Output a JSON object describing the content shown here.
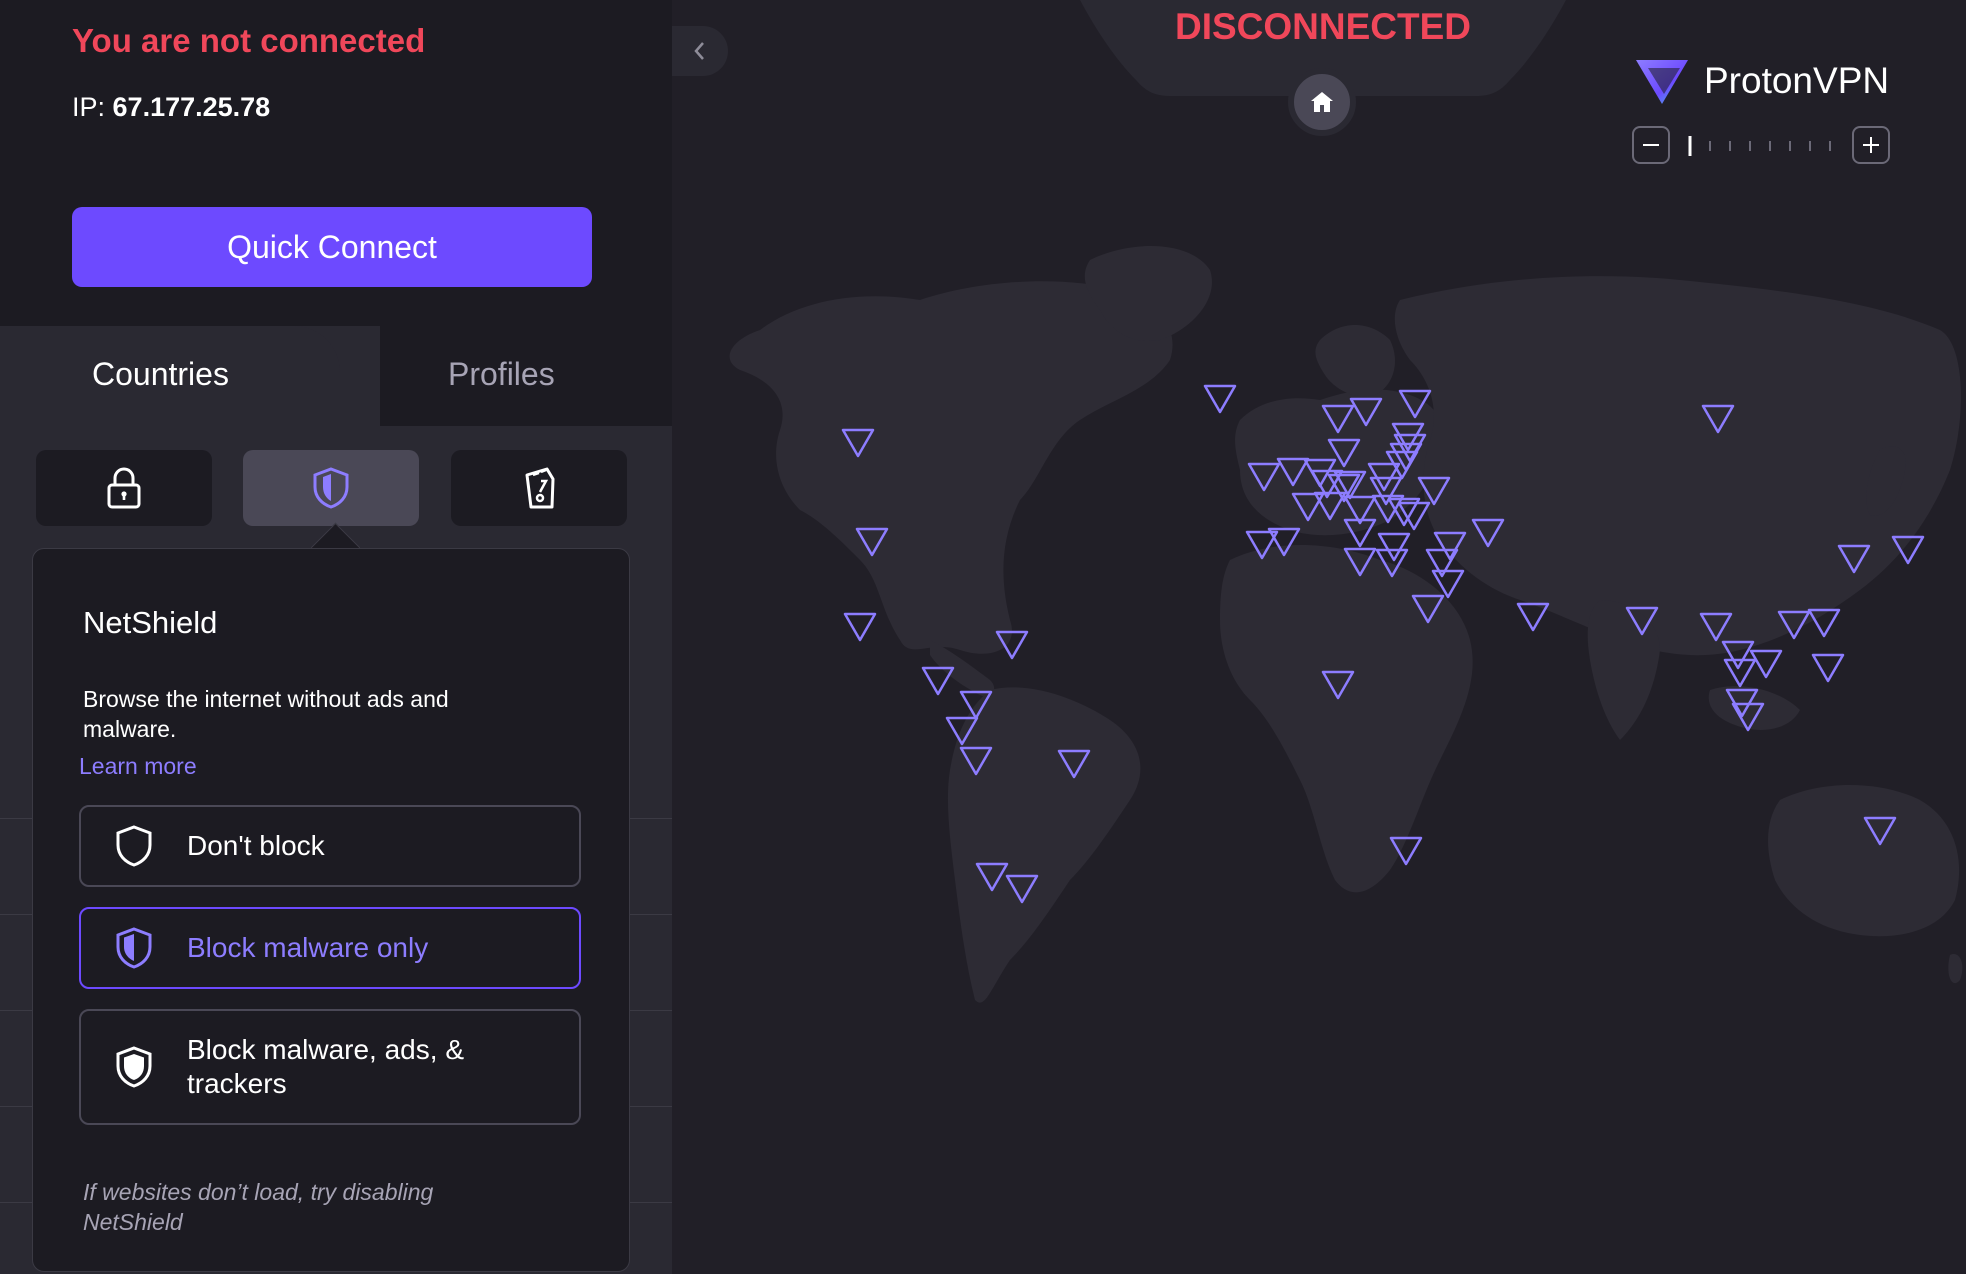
{
  "status": {
    "text": "You are not connected",
    "ip_label": "IP:",
    "ip_value": "67.177.25.78",
    "color": "#f0475a"
  },
  "quick_connect": {
    "label": "Quick Connect",
    "color": "#6d4aff"
  },
  "tabs": [
    {
      "label": "Countries",
      "active": true
    },
    {
      "label": "Profiles",
      "active": false
    }
  ],
  "features": [
    {
      "icon": "lock-icon",
      "active": false
    },
    {
      "icon": "shield-icon",
      "active": true
    },
    {
      "icon": "streaming-icon",
      "active": false
    }
  ],
  "netshield_popover": {
    "title": "NetShield",
    "description": "Browse the internet without ads and malware.",
    "learn_more": "Learn more",
    "options": [
      {
        "label": "Don't block",
        "icon": "shield-outline-icon",
        "selected": false
      },
      {
        "label": "Block malware only",
        "icon": "shield-half-icon",
        "selected": true
      },
      {
        "label": "Block malware, ads, & trackers",
        "icon": "shield-full-icon",
        "selected": false
      }
    ],
    "footer": "If websites don’t load, try disabling NetShield"
  },
  "map": {
    "connection_status": "DISCONNECTED",
    "brand_name": "ProtonVPN",
    "accent_color": "#8d7dff",
    "zoom_level": 0
  }
}
